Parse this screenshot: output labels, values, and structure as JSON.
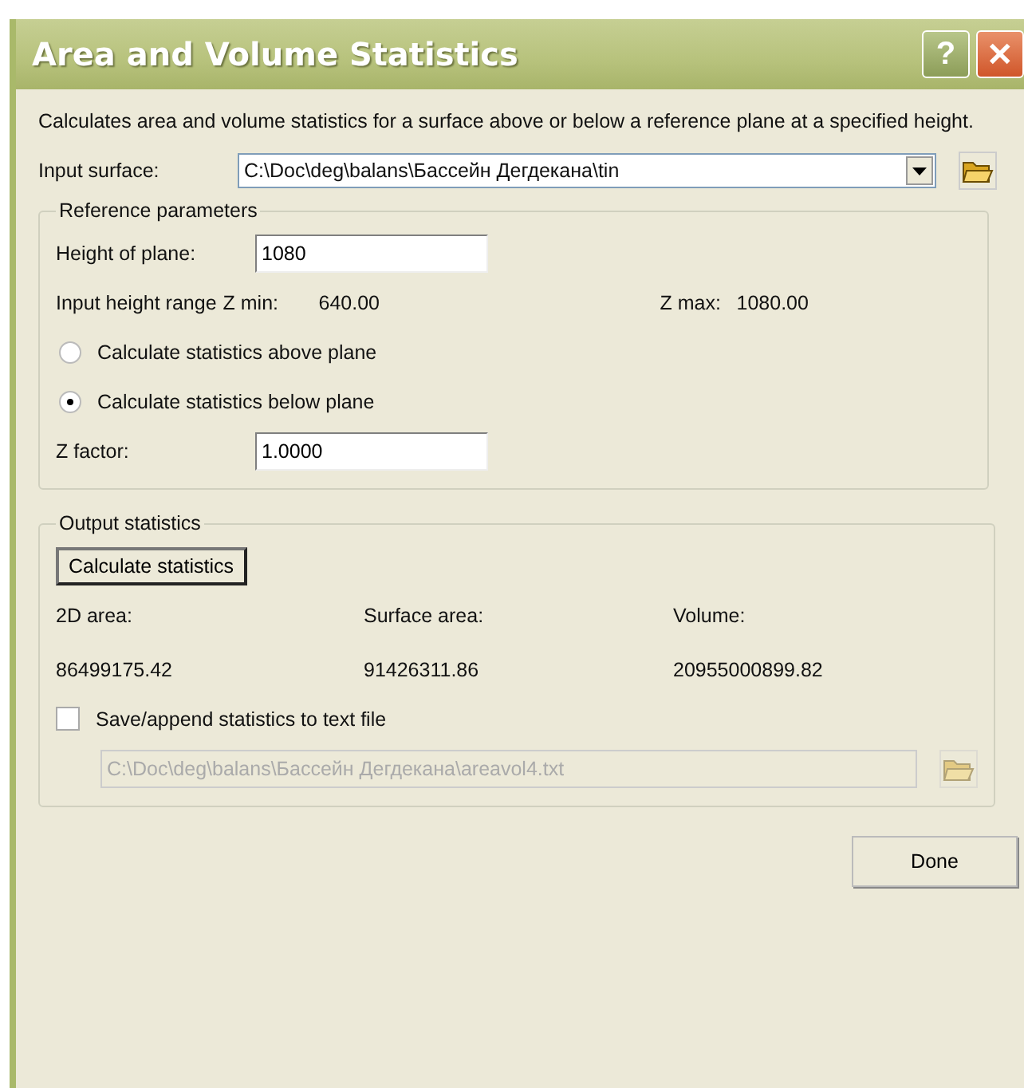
{
  "window": {
    "title": "Area and Volume Statistics",
    "title_buttons": [
      "?",
      "✕"
    ]
  },
  "description": "Calculates area and volume statistics for a surface above or below a reference plane at a specified height.",
  "input_surface": {
    "label": "Input surface:",
    "value": "C:\\Doc\\deg\\balans\\Бассейн Дегдекана\\tin"
  },
  "reference": {
    "legend": "Reference parameters",
    "height": {
      "label": "Height of plane:",
      "value": "1080"
    },
    "range": {
      "label": "Input height range",
      "zmin_label": "Z min:",
      "zmin": "640.00",
      "zmax_label": "Z max:",
      "zmax": "1080.00"
    },
    "options": [
      {
        "label": "Calculate statistics above plane",
        "selected": false
      },
      {
        "label": "Calculate statistics below plane",
        "selected": true
      }
    ],
    "zfactor": {
      "label": "Z factor:",
      "value": "1.0000"
    }
  },
  "output": {
    "legend": "Output statistics",
    "button": "Calculate statistics",
    "stats": [
      {
        "label": "2D area:",
        "value": "86499175.42"
      },
      {
        "label": "Surface area:",
        "value": "91426311.86"
      },
      {
        "label": "Volume:",
        "value": "20955000899.82"
      }
    ],
    "save": {
      "label": "Save/append statistics to text file",
      "checked": false
    },
    "file": {
      "value": "C:\\Doc\\deg\\balans\\Бассейн Дегдекана\\areavol4.txt",
      "disabled": true
    }
  },
  "done_button": "Done"
}
